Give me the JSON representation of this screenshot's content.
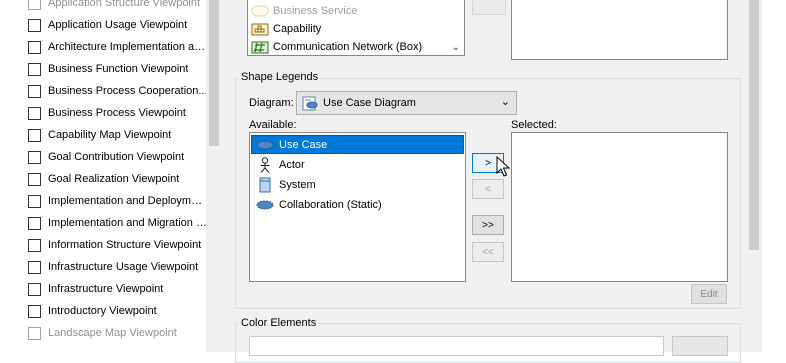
{
  "viewpoints": [
    {
      "label": "Application Structure Viewpoint",
      "faded": true
    },
    {
      "label": "Application Usage Viewpoint"
    },
    {
      "label": "Architecture Implementation an..."
    },
    {
      "label": "Business Function Viewpoint"
    },
    {
      "label": "Business Process Cooperation..."
    },
    {
      "label": "Business Process Viewpoint"
    },
    {
      "label": "Capability Map Viewpoint"
    },
    {
      "label": "Goal Contribution Viewpoint"
    },
    {
      "label": "Goal Realization Viewpoint"
    },
    {
      "label": "Implementation and Deploymen..."
    },
    {
      "label": "Implementation and Migration V..."
    },
    {
      "label": "Information Structure Viewpoint"
    },
    {
      "label": "Infrastructure Usage Viewpoint"
    },
    {
      "label": "Infrastructure Viewpoint"
    },
    {
      "label": "Introductory Viewpoint"
    },
    {
      "label": "Landscape Map Viewpoint",
      "faded": true
    }
  ],
  "top_list": {
    "items": [
      {
        "label": "Business Service",
        "icon": "business-service-icon"
      },
      {
        "label": "Capability",
        "icon": "capability-icon"
      },
      {
        "label": "Communication Network (Box)",
        "icon": "communication-network-icon"
      }
    ]
  },
  "shape_legends": {
    "title": "Shape Legends",
    "diagram_label": "Diagram:",
    "diagram_value": "Use Case Diagram",
    "available_label": "Available:",
    "selected_label": "Selected:",
    "available_items": [
      {
        "label": "Use Case",
        "icon": "use-case-icon",
        "selected": true
      },
      {
        "label": "Actor",
        "icon": "actor-icon"
      },
      {
        "label": "System",
        "icon": "system-icon"
      },
      {
        "label": "Collaboration (Static)",
        "icon": "collaboration-icon"
      }
    ],
    "buttons": {
      "add": ">",
      "remove": "<",
      "add_all": ">>",
      "remove_all": "<<",
      "edit": "Edit"
    }
  },
  "color_elements": {
    "title": "Color Elements"
  },
  "colors": {
    "accent": "#0078d7",
    "panel": "#f0f0f0",
    "border": "#828790"
  }
}
